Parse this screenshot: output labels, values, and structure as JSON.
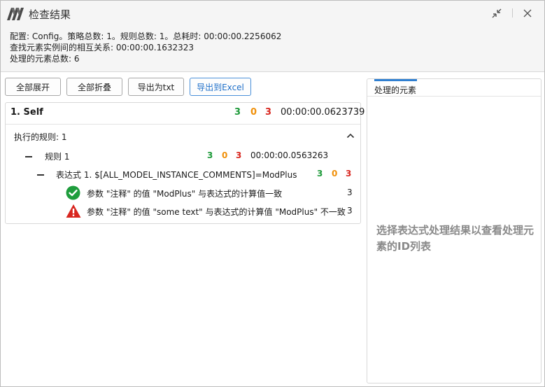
{
  "window": {
    "title": "检查结果",
    "accent_color": "#2f7fd1"
  },
  "info": {
    "line1": "配置: Config。策略总数: 1。规则总数: 1。总耗时: 00:00:00.2256062",
    "line2": "查找元素实例间的相互关系: 00:00:00.1632323",
    "line3": "处理的元素总数: 6"
  },
  "toolbar": {
    "expand_all": "全部展开",
    "collapse_all": "全部折叠",
    "export_txt": "导出为txt",
    "export_excel": "导出到Excel"
  },
  "results": {
    "policy": {
      "title": "1. Self",
      "pass": "3",
      "warn": "0",
      "fail": "3",
      "time": "00:00:00.0623739"
    },
    "executed_rules_label": "执行的规则: 1",
    "rule": {
      "label": "规则 1",
      "pass": "3",
      "warn": "0",
      "fail": "3",
      "time": "00:00:00.0563263"
    },
    "expression": {
      "label": "表达式 1. $[ALL_MODEL_INSTANCE_COMMENTS]=ModPlus",
      "pass": "3",
      "warn": "0",
      "fail": "3"
    },
    "checks": [
      {
        "icon": "check-circle-icon",
        "text": "参数 \"注释\" 的值 \"ModPlus\" 与表达式的计算值一致",
        "count": "3"
      },
      {
        "icon": "warning-triangle-icon",
        "text": "参数 \"注释\" 的值 \"some text\" 与表达式的计算值 \"ModPlus\" 不一致",
        "count": "3"
      }
    ]
  },
  "side_panel": {
    "tab": "处理的元素",
    "hint": "选择表达式处理结果以查看处理元素的ID列表"
  }
}
